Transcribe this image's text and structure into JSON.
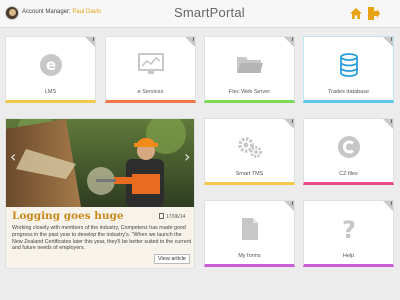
{
  "header": {
    "manager_label": "Account Manager:",
    "manager_name": "Paul Davis",
    "brand": "SmartPortal",
    "icons": [
      "home-icon",
      "logout-icon"
    ],
    "accent": "#e8a317"
  },
  "tiles": [
    {
      "label": "LMS",
      "icon": "lms-e-icon",
      "accent": "#f2c94c"
    },
    {
      "label": "e Services",
      "icon": "monitor-chart-icon",
      "accent": "#f0784a"
    },
    {
      "label": "Ftec Web Server",
      "icon": "folder-icon",
      "accent": "#7ed957"
    },
    {
      "label": "Trades database",
      "icon": "database-icon",
      "accent": "#5bc8e8"
    },
    {
      "label": "Smart TMS",
      "icon": "gears-icon",
      "accent": "#f2c94c"
    },
    {
      "label": "CZ files",
      "icon": "copyright-icon",
      "accent": "#e84a8a"
    },
    {
      "label": "My forms",
      "icon": "document-icon",
      "accent": "#c85fd6"
    },
    {
      "label": "Help",
      "icon": "question-icon",
      "accent": "#c85fd6"
    }
  ],
  "tile_info": "i",
  "news": {
    "title": "Logging goes huge",
    "date": "17/06/14",
    "body": "Working closely with members of the industry, Competenz has made good progress in the past year to develop the industry's. \"When we launch the New Zealand Certificates later this year, they'll be better suited to the current and future needs of employers.",
    "view_label": "View article",
    "arrow_left": "‹",
    "arrow_right": "›"
  }
}
